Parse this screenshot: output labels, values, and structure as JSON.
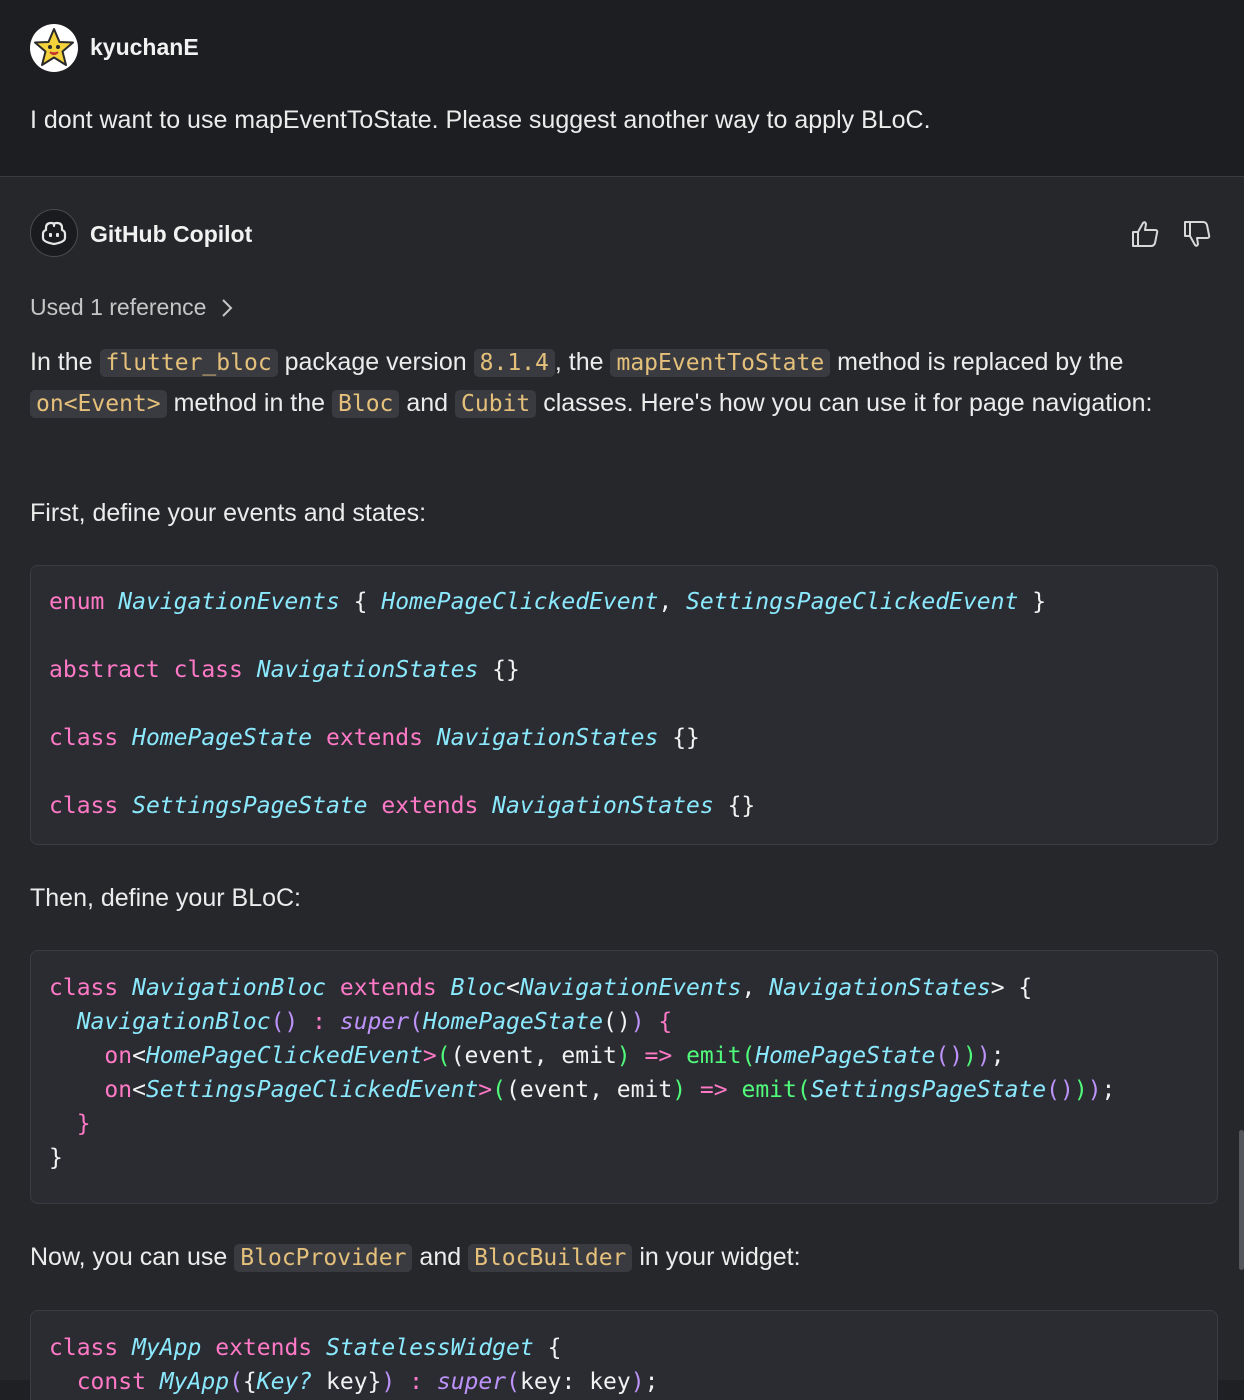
{
  "user": {
    "name": "kyuchanE",
    "message": "I dont want to use mapEventToState. Please suggest another way to apply BLoC."
  },
  "copilot": {
    "name": "GitHub Copilot",
    "references_label": "Used 1 reference"
  },
  "content": {
    "intro": {
      "t1": "In the ",
      "c1": "flutter_bloc",
      "t2": " package version ",
      "c2": "8.1.4",
      "t3": ", the ",
      "c3": "mapEventToState",
      "t4": " method is replaced by the ",
      "c4": "on<Event>",
      "t5": " method in the ",
      "c5": "Bloc",
      "t6": " and ",
      "c6": "Cubit",
      "t7": " classes. Here's how you can use it for page navigation:"
    },
    "step1": "First, define your events and states:",
    "step2": "Then, define your BLoC:",
    "step3": {
      "t1": "Now, you can use ",
      "c1": "BlocProvider",
      "t2": " and ",
      "c2": "BlocBuilder",
      "t3": " in your widget:"
    }
  },
  "code_blocks": [
    {
      "lines": [
        "enum NavigationEvents { HomePageClickedEvent, SettingsPageClickedEvent }",
        "",
        "abstract class NavigationStates {}",
        "",
        "class HomePageState extends NavigationStates {}",
        "",
        "class SettingsPageState extends NavigationStates {}"
      ]
    },
    {
      "lines": [
        "class NavigationBloc extends Bloc<NavigationEvents, NavigationStates> {",
        "  NavigationBloc() : super(HomePageState()) {",
        "    on<HomePageClickedEvent>((event, emit) => emit(HomePageState()));",
        "    on<SettingsPageClickedEvent>((event, emit) => emit(SettingsPageState()));",
        "  }",
        "}"
      ]
    },
    {
      "lines": [
        "class MyApp extends StatelessWidget {",
        "  const MyApp({Key? key}) : super(key: key);"
      ]
    }
  ],
  "icons": {
    "user_avatar": "star-avatar-icon",
    "copilot_avatar": "copilot-icon",
    "thumbs_up": "thumbs-up-icon",
    "thumbs_down": "thumbs-down-icon",
    "chevron": "chevron-right-icon"
  },
  "colors": {
    "background": "#26272b",
    "keyword": "#ff79c6",
    "type": "#8be9fd",
    "function": "#50fa7b",
    "inline_code": "#e5c07b"
  }
}
